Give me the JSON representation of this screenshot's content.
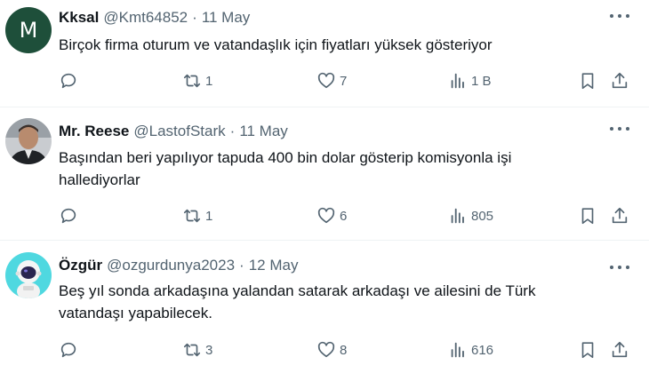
{
  "tweets": [
    {
      "avatar_letter": "M",
      "name": "Kksal",
      "handle": "@Kmt64852",
      "sep": "·",
      "date": "11 May",
      "lines": [
        "Birçok firma oturum ve vatandaşlık için fiyatları yüksek gösteriyor"
      ],
      "retweets": "1",
      "likes": "7",
      "views": "1 B"
    },
    {
      "name": "Mr. Reese",
      "handle": "@LastofStark",
      "sep": "·",
      "date": "11 May",
      "lines": [
        "Başından beri yapılıyor tapuda 400 bin dolar gösterip komisyonla işi",
        "hallediyorlar"
      ],
      "retweets": "1",
      "likes": "6",
      "views": "805"
    },
    {
      "name": "Özgür",
      "handle": "@ozgurdunya2023",
      "sep": "·",
      "date": "12 May",
      "lines": [
        "Beş yıl sonda arkadaşına yalandan satarak arkadaşı ve ailesini de Türk",
        "vatandaşı yapabilecek."
      ],
      "retweets": "3",
      "likes": "8",
      "views": "616"
    }
  ],
  "icons": {
    "reply": "reply-icon",
    "retweet": "retweet-icon",
    "like": "heart-icon",
    "views": "views-icon",
    "bookmark": "bookmark-icon",
    "share": "share-icon",
    "more": "more-icon"
  },
  "colors": {
    "text": "#0f1419",
    "secondary": "#536471",
    "divider": "#eff3f4"
  }
}
